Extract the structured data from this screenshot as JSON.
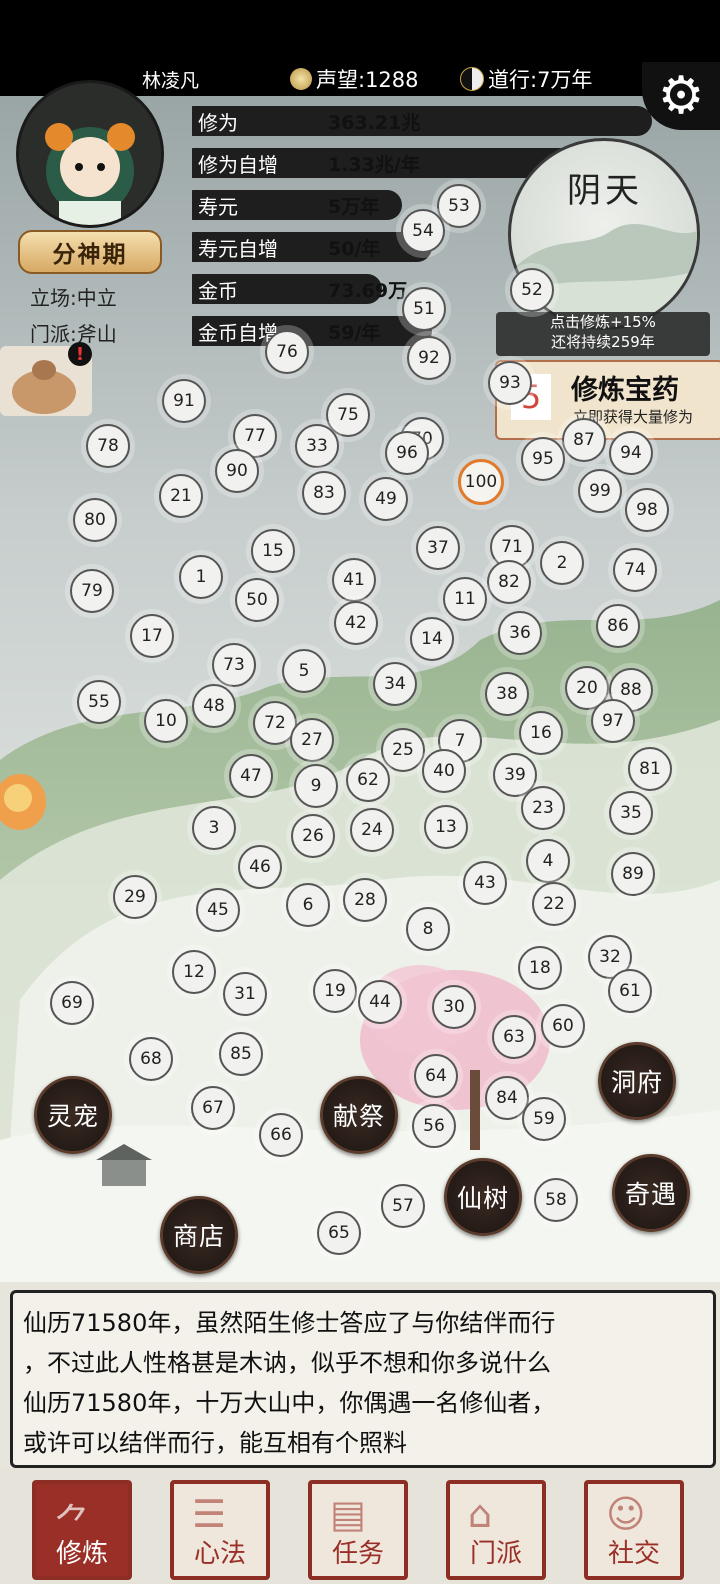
{
  "top": {
    "player_name": "林凌凡",
    "reputation": "声望:1288",
    "dao": "道行:7万年"
  },
  "player": {
    "realm": "分神期",
    "stance": "立场:中立",
    "sect": "门派:斧山"
  },
  "stats": [
    {
      "label": "修为",
      "value": "363.21兆"
    },
    {
      "label": "修为自增",
      "value": "1.33兆/年"
    },
    {
      "label": "寿元",
      "value": "5万年"
    },
    {
      "label": "寿元自增",
      "value": "50/年"
    },
    {
      "label": "金币",
      "value": "73.69万"
    },
    {
      "label": "金币自增",
      "value": "59/年"
    }
  ],
  "weather": {
    "title": "阴天",
    "line1": "点击修炼+15%",
    "line2": "还将持续259年"
  },
  "medicine": {
    "count": "5",
    "title": "修炼宝药",
    "subtitle": "立即获得大量修为"
  },
  "nodes": [
    {
      "n": "53"
    },
    {
      "n": "54"
    },
    {
      "n": "52"
    },
    {
      "n": "51"
    },
    {
      "n": "76"
    },
    {
      "n": "92"
    },
    {
      "n": "93"
    },
    {
      "n": "91"
    },
    {
      "n": "75"
    },
    {
      "n": "78"
    },
    {
      "n": "77"
    },
    {
      "n": "33"
    },
    {
      "n": "70"
    },
    {
      "n": "96"
    },
    {
      "n": "87"
    },
    {
      "n": "95"
    },
    {
      "n": "94"
    },
    {
      "n": "90"
    },
    {
      "n": "100",
      "hl": true
    },
    {
      "n": "21"
    },
    {
      "n": "83"
    },
    {
      "n": "49"
    },
    {
      "n": "99"
    },
    {
      "n": "98"
    },
    {
      "n": "80"
    },
    {
      "n": "15"
    },
    {
      "n": "37"
    },
    {
      "n": "71"
    },
    {
      "n": "2"
    },
    {
      "n": "74"
    },
    {
      "n": "1"
    },
    {
      "n": "41"
    },
    {
      "n": "82"
    },
    {
      "n": "79"
    },
    {
      "n": "50"
    },
    {
      "n": "11"
    },
    {
      "n": "42"
    },
    {
      "n": "17"
    },
    {
      "n": "14"
    },
    {
      "n": "36"
    },
    {
      "n": "86"
    },
    {
      "n": "73"
    },
    {
      "n": "5"
    },
    {
      "n": "34"
    },
    {
      "n": "55"
    },
    {
      "n": "48"
    },
    {
      "n": "38"
    },
    {
      "n": "20"
    },
    {
      "n": "88"
    },
    {
      "n": "10"
    },
    {
      "n": "72"
    },
    {
      "n": "97"
    },
    {
      "n": "27"
    },
    {
      "n": "16"
    },
    {
      "n": "7"
    },
    {
      "n": "25"
    },
    {
      "n": "47"
    },
    {
      "n": "9"
    },
    {
      "n": "62"
    },
    {
      "n": "40"
    },
    {
      "n": "39"
    },
    {
      "n": "81"
    },
    {
      "n": "23"
    },
    {
      "n": "35"
    },
    {
      "n": "3"
    },
    {
      "n": "26"
    },
    {
      "n": "24"
    },
    {
      "n": "13"
    },
    {
      "n": "46"
    },
    {
      "n": "4"
    },
    {
      "n": "89"
    },
    {
      "n": "29"
    },
    {
      "n": "45"
    },
    {
      "n": "6"
    },
    {
      "n": "28"
    },
    {
      "n": "43"
    },
    {
      "n": "22"
    },
    {
      "n": "8"
    },
    {
      "n": "32"
    },
    {
      "n": "18"
    },
    {
      "n": "12"
    },
    {
      "n": "61"
    },
    {
      "n": "69"
    },
    {
      "n": "31"
    },
    {
      "n": "19"
    },
    {
      "n": "44"
    },
    {
      "n": "30"
    },
    {
      "n": "60"
    },
    {
      "n": "63"
    },
    {
      "n": "68"
    },
    {
      "n": "85"
    },
    {
      "n": "64"
    },
    {
      "n": "84"
    },
    {
      "n": "67"
    },
    {
      "n": "59"
    },
    {
      "n": "66"
    },
    {
      "n": "56"
    },
    {
      "n": "57"
    },
    {
      "n": "58"
    },
    {
      "n": "65"
    }
  ],
  "round_buttons": {
    "pet": "灵宠",
    "sacrifice": "献祭",
    "cave": "洞府",
    "tree": "仙树",
    "encounter": "奇遇",
    "shop": "商店"
  },
  "log": [
    "仙历71580年，虽然陌生修士答应了与你结伴而行",
    "，不过此人性格甚是木讷，似乎不想和你多说什么",
    "仙历71580年，十万大山中，你偶遇一名修仙者，",
    "或许可以结伴而行，能互相有个照料"
  ],
  "nav": [
    {
      "label": "修炼",
      "active": true
    },
    {
      "label": "心法"
    },
    {
      "label": "任务"
    },
    {
      "label": "门派"
    },
    {
      "label": "社交"
    }
  ]
}
